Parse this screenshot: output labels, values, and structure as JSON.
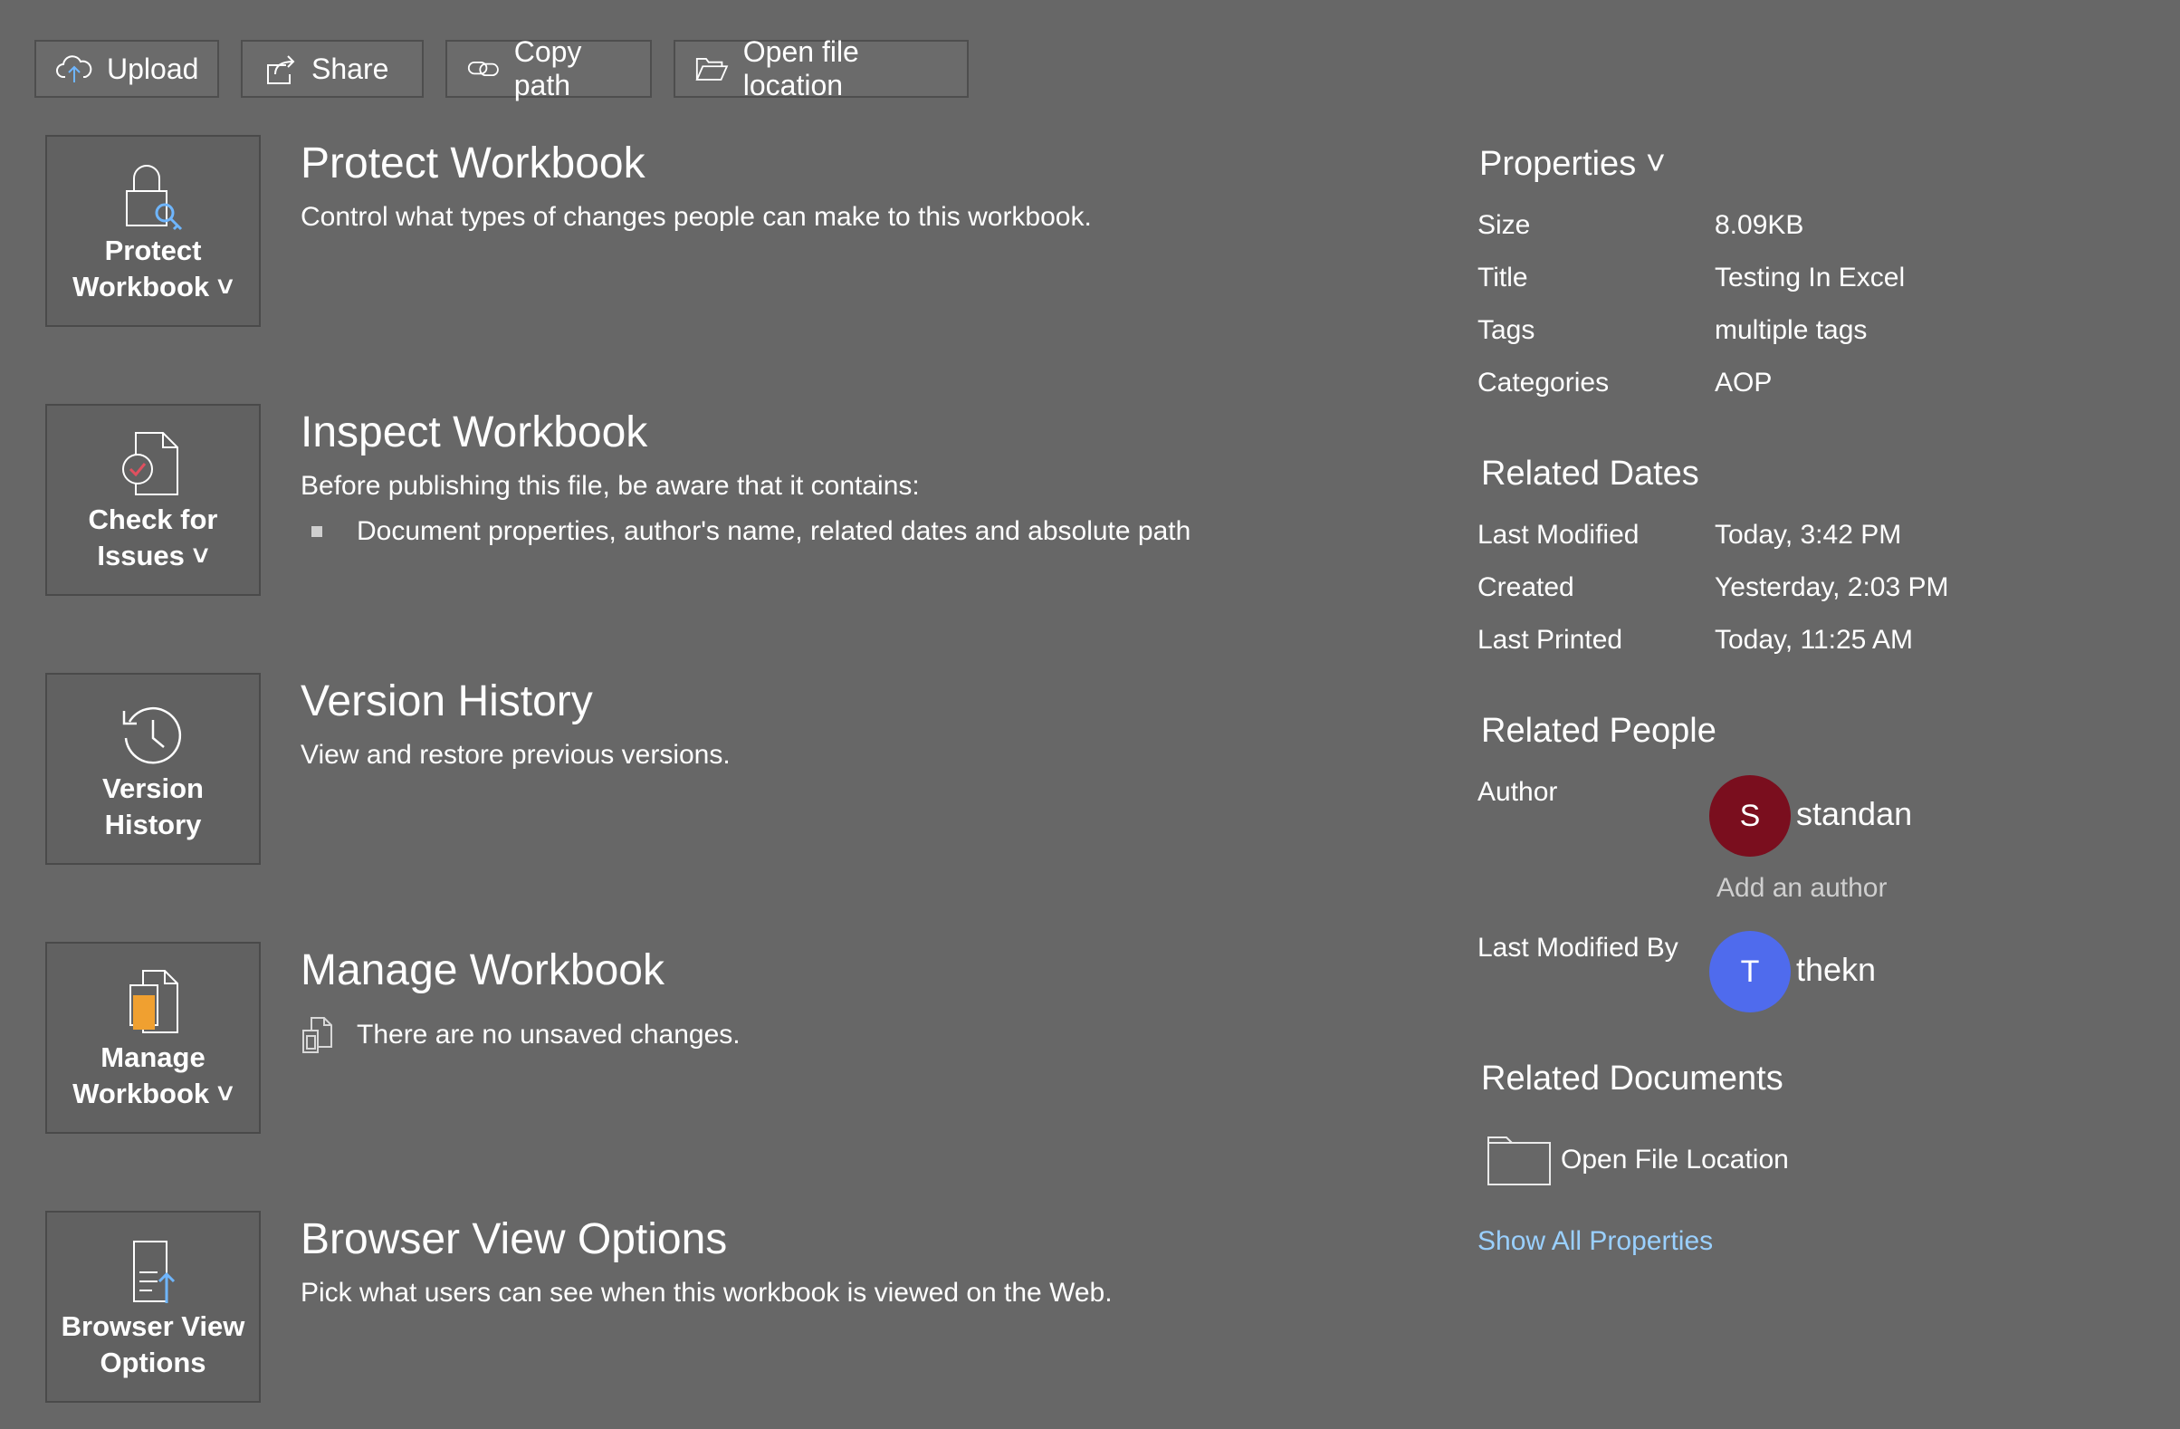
{
  "toolbar": {
    "upload": "Upload",
    "share": "Share",
    "copy_path": "Copy path",
    "open_location": "Open file location"
  },
  "sections": [
    {
      "tile_line1": "Protect",
      "tile_line2": "Workbook ˅",
      "title": "Protect Workbook",
      "desc": "Control what types of changes people can make to this workbook.",
      "icon": "lock-icon"
    },
    {
      "tile_line1": "Check for",
      "tile_line2": "Issues ˅",
      "title": "Inspect Workbook",
      "desc": "Before publishing this file, be aware that it contains:",
      "bullet": "Document properties, author's name, related dates and absolute path",
      "icon": "inspect-document-icon"
    },
    {
      "tile_line1": "Version",
      "tile_line2": "History",
      "title": "Version History",
      "desc": "View and restore previous versions.",
      "icon": "history-icon"
    },
    {
      "tile_line1": "Manage",
      "tile_line2": "Workbook ˅",
      "title": "Manage Workbook",
      "desc": "There are no unsaved changes.",
      "icon": "manage-workbook-icon"
    },
    {
      "tile_line1": "Browser View",
      "tile_line2": "Options",
      "title": "Browser View Options",
      "desc": "Pick what users can see when this workbook is viewed on the Web.",
      "icon": "browser-view-icon"
    }
  ],
  "properties": {
    "heading": "Properties ˅",
    "rows": [
      {
        "key": "Size",
        "value": "8.09KB"
      },
      {
        "key": "Title",
        "value": "Testing In Excel"
      },
      {
        "key": "Tags",
        "value": "multiple tags"
      },
      {
        "key": "Categories",
        "value": "AOP"
      }
    ]
  },
  "related_dates": {
    "heading": "Related Dates",
    "rows": [
      {
        "key": "Last Modified",
        "value": "Today, 3:42 PM"
      },
      {
        "key": "Created",
        "value": "Yesterday, 2:03 PM"
      },
      {
        "key": "Last Printed",
        "value": "Today, 11:25 AM"
      }
    ]
  },
  "related_people": {
    "heading": "Related People",
    "author_label": "Author",
    "author_initial": "S",
    "author_name": "standan",
    "author_color": "#7a0e1e",
    "add_author": "Add an author",
    "last_modified_by_label": "Last Modified By",
    "modifier_initial": "T",
    "modifier_name": "thekn",
    "modifier_color": "#4f6bed"
  },
  "related_documents": {
    "heading": "Related Documents",
    "open_location": "Open File Location",
    "show_all": "Show All Properties"
  }
}
